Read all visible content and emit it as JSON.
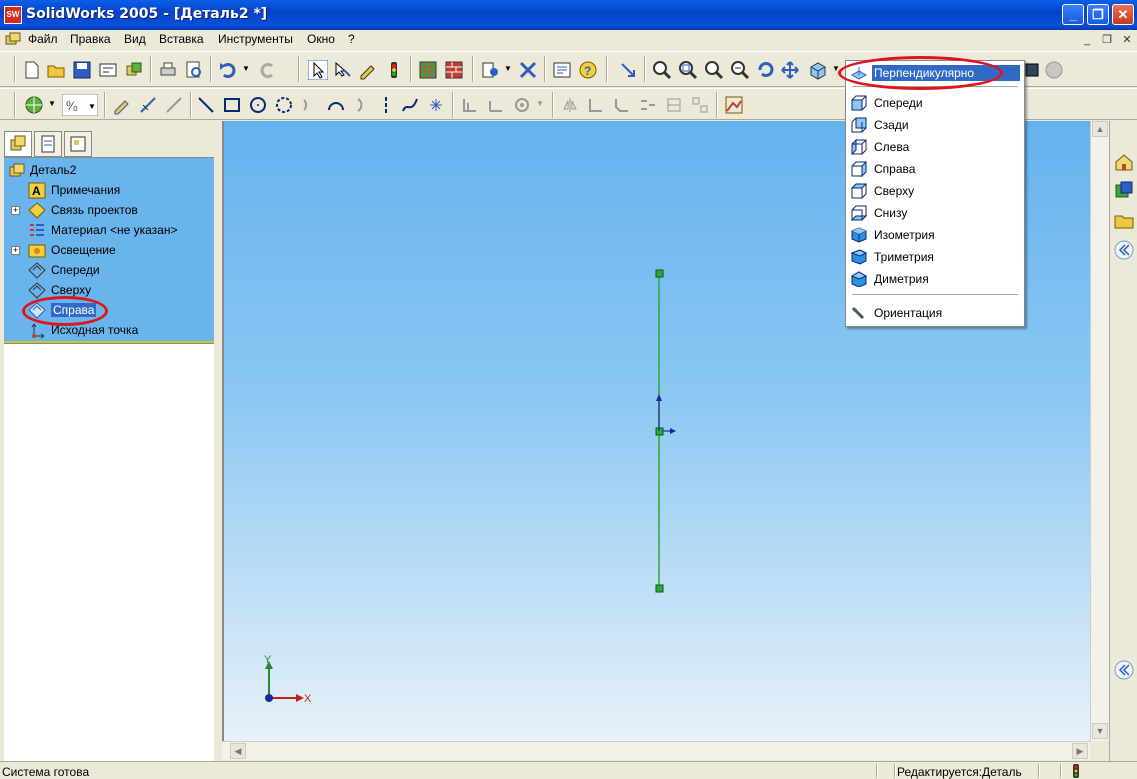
{
  "window": {
    "title": "SolidWorks 2005 - [Деталь2 *]",
    "app_badge": "SW"
  },
  "menubar": {
    "items": [
      "Файл",
      "Правка",
      "Вид",
      "Вставка",
      "Инструменты",
      "Окно",
      "?"
    ]
  },
  "feature_tree": {
    "root": "Деталь2",
    "items": [
      {
        "label": "Примечания",
        "icon": "annotations-icon",
        "expandable": false
      },
      {
        "label": "Связь проектов",
        "icon": "design-binder-icon",
        "expandable": true
      },
      {
        "label": "Материал <не указан>",
        "icon": "material-icon",
        "expandable": false
      },
      {
        "label": "Освещение",
        "icon": "lighting-icon",
        "expandable": true
      },
      {
        "label": "Спереди",
        "icon": "plane-icon",
        "expandable": false
      },
      {
        "label": "Сверху",
        "icon": "plane-icon",
        "expandable": false
      },
      {
        "label": "Справа",
        "icon": "plane-icon",
        "expandable": false,
        "selected": true
      },
      {
        "label": "Исходная точка",
        "icon": "origin-icon",
        "expandable": false
      }
    ]
  },
  "view_orientation_menu": {
    "items": [
      {
        "label": "Перпендикулярно",
        "icon": "normal-to-icon",
        "highlighted": true
      },
      {
        "label": "Спереди",
        "icon": "view-front-icon"
      },
      {
        "label": "Сзади",
        "icon": "view-back-icon"
      },
      {
        "label": "Слева",
        "icon": "view-left-icon"
      },
      {
        "label": "Справа",
        "icon": "view-right-icon"
      },
      {
        "label": "Сверху",
        "icon": "view-top-icon"
      },
      {
        "label": "Снизу",
        "icon": "view-bottom-icon"
      },
      {
        "label": "Изометрия",
        "icon": "view-isometric-icon"
      },
      {
        "label": "Триметрия",
        "icon": "view-trimetric-icon"
      },
      {
        "label": "Диметрия",
        "icon": "view-dimetric-icon"
      },
      {
        "label": "Ориентация",
        "icon": "orientation-icon"
      }
    ]
  },
  "triad": {
    "x_label": "X",
    "y_label": "Y"
  },
  "status": {
    "left": "Система готова",
    "right": "Редактируется:Деталь"
  },
  "colors": {
    "highlight": "#316ac5",
    "annotation_red": "#e0141a",
    "sketch_line": "#2aa83a",
    "tree_background": "#69b4ec"
  }
}
